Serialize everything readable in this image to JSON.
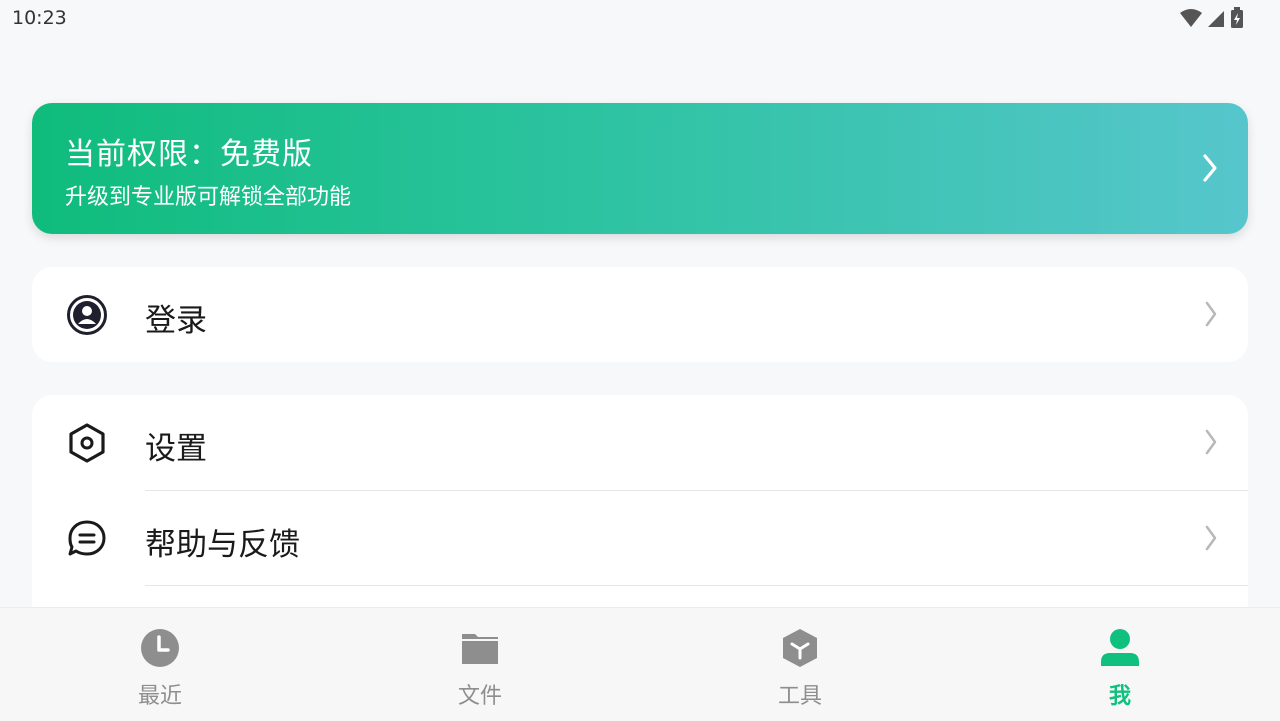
{
  "status_bar": {
    "time": "10:23"
  },
  "promo": {
    "title": "当前权限：免费版",
    "subtitle": "升级到专业版可解锁全部功能"
  },
  "login": {
    "label": "登录",
    "icon": "user-circle-icon"
  },
  "menu": {
    "items": [
      {
        "label": "设置",
        "icon": "hexagon-settings-icon"
      },
      {
        "label": "帮助与反馈",
        "icon": "chat-bubble-icon"
      }
    ]
  },
  "tabbar": {
    "tabs": [
      {
        "label": "最近",
        "icon": "clock-icon"
      },
      {
        "label": "文件",
        "icon": "folder-icon"
      },
      {
        "label": "工具",
        "icon": "cube-icon"
      },
      {
        "label": "我",
        "icon": "person-icon"
      }
    ],
    "active_index": 3
  },
  "colors": {
    "accent": "#10c07e",
    "gradient_start": "#0fbc7c",
    "gradient_end": "#56c6cc",
    "inactive_tab": "#8e8e8e"
  }
}
